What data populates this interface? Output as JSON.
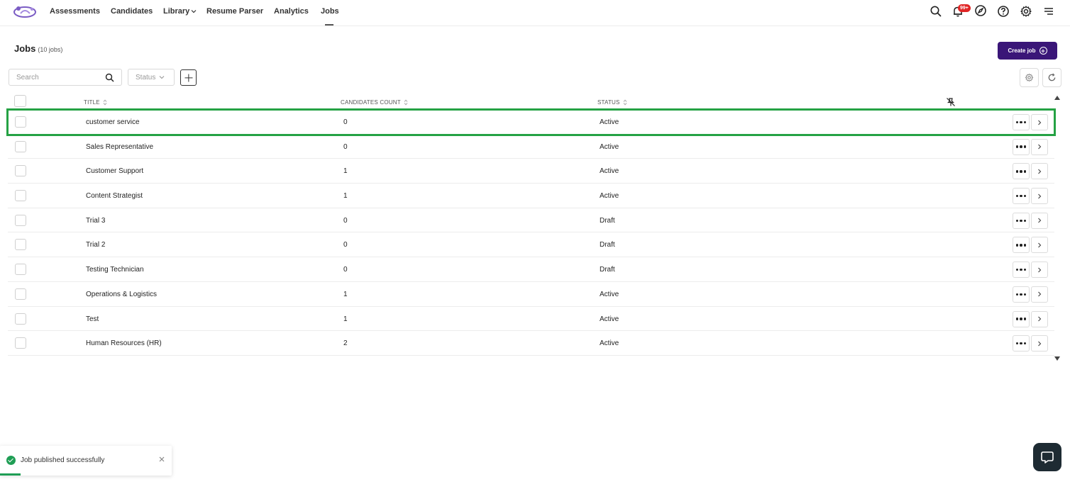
{
  "nav": {
    "items": [
      {
        "label": "Assessments"
      },
      {
        "label": "Candidates"
      },
      {
        "label": "Library"
      },
      {
        "label": "Resume Parser"
      },
      {
        "label": "Analytics"
      },
      {
        "label": "Jobs"
      }
    ],
    "active": "Jobs",
    "notification_badge": "99+",
    "icons": [
      "search-icon",
      "bell-icon",
      "compass-icon",
      "help-circle-icon",
      "gear-icon",
      "menu-icon"
    ]
  },
  "header": {
    "title": "Jobs",
    "count_label": "(10 jobs)",
    "create_label": "Create job"
  },
  "filters": {
    "search_placeholder": "Search",
    "status_label": "Status"
  },
  "table": {
    "columns": {
      "title": "TITLE",
      "candidates": "CANDIDATES COUNT",
      "status": "STATUS"
    },
    "rows": [
      {
        "title": "customer service",
        "count": "0",
        "status": "Active",
        "highlighted": true
      },
      {
        "title": "Sales Representative",
        "count": "0",
        "status": "Active"
      },
      {
        "title": "Customer Support",
        "count": "1",
        "status": "Active"
      },
      {
        "title": "Content Strategist",
        "count": "1",
        "status": "Active"
      },
      {
        "title": "Trial 3",
        "count": "0",
        "status": "Draft"
      },
      {
        "title": "Trial 2",
        "count": "0",
        "status": "Draft"
      },
      {
        "title": "Testing Technician",
        "count": "0",
        "status": "Draft"
      },
      {
        "title": "Operations & Logistics",
        "count": "1",
        "status": "Active"
      },
      {
        "title": "Test",
        "count": "1",
        "status": "Active"
      },
      {
        "title": "Human Resources (HR)",
        "count": "2",
        "status": "Active"
      }
    ]
  },
  "toast": {
    "message": "Job published successfully",
    "progress": 0.12
  },
  "colors": {
    "brand": "#3a1678",
    "highlight": "#25a244",
    "success": "#1f9e55",
    "badge": "#e02424",
    "help_button": "#1e2b33"
  }
}
